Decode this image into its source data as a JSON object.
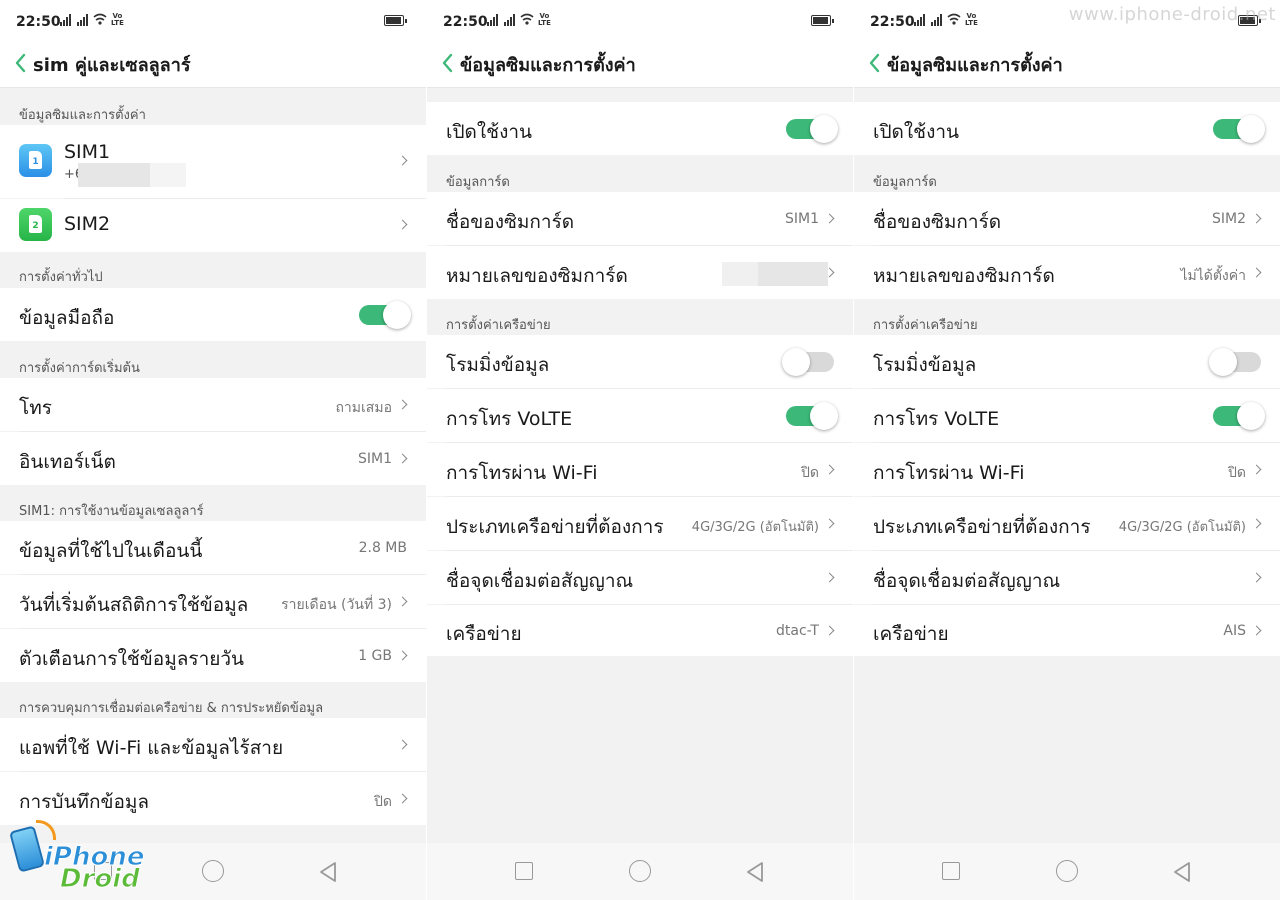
{
  "status": {
    "time": "22:50",
    "volte_top": "Vo",
    "volte_bottom": "LTE"
  },
  "watermark": "www.iphone-droid.net",
  "logo": {
    "line1": "iPhone",
    "line2": "Droid"
  },
  "screen1": {
    "title": "sim คู่และเซลลูลาร์",
    "section_sim": "ข้อมูลซิมและการตั้งค่า",
    "sim1": {
      "name": "SIM1",
      "number_prefix": "+6",
      "icon_digit": "1"
    },
    "sim2": {
      "name": "SIM2",
      "icon_digit": "2"
    },
    "section_general": "การตั้งค่าทั่วไป",
    "mobile_data": {
      "label": "ข้อมูลมือถือ",
      "state": "on"
    },
    "section_default": "การตั้งค่าการ์ดเริ่มต้น",
    "call": {
      "label": "โทร",
      "value": "ถามเสมอ"
    },
    "internet": {
      "label": "อินเทอร์เน็ต",
      "value": "SIM1"
    },
    "section_usage": "SIM1: การใช้งานข้อมูลเซลลูลาร์",
    "used": {
      "label": "ข้อมูลที่ใช้ไปในเดือนนี้",
      "value": "2.8 MB"
    },
    "start_date": {
      "label": "วันที่เริ่มต้นสถิติการใช้ข้อมูล",
      "value": "รายเดือน (วันที่ 3)"
    },
    "daily_alert": {
      "label": "ตัวเตือนการใช้ข้อมูลรายวัน",
      "value": "1 GB"
    },
    "section_control": "การควบคุมการเชื่อมต่อเครือข่าย & การประหยัดข้อมูล",
    "apps_wifi": {
      "label": "แอพที่ใช้ Wi-Fi และข้อมูลไร้สาย"
    },
    "data_saving": {
      "label": "การบันทึกข้อมูล",
      "value": "ปิด"
    }
  },
  "screen2": {
    "title": "ข้อมูลซิมและการตั้งค่า",
    "enable": {
      "label": "เปิดใช้งาน",
      "state": "on"
    },
    "section_card": "ข้อมูลการ์ด",
    "card_name": {
      "label": "ชื่อของซิมการ์ด",
      "value": "SIM1"
    },
    "card_number": {
      "label": "หมายเลขของซิมการ์ด"
    },
    "section_network": "การตั้งค่าเครือข่าย",
    "roaming": {
      "label": "โรมมิ่งข้อมูล",
      "state": "off"
    },
    "volte": {
      "label": "การโทร VoLTE",
      "state": "on"
    },
    "wifi_call": {
      "label": "การโทรผ่าน Wi-Fi",
      "value": "ปิด"
    },
    "network_type": {
      "label": "ประเภทเครือข่ายที่ต้องการ",
      "value": "4G/3G/2G (อัตโนมัติ)"
    },
    "apn": {
      "label": "ชื่อจุดเชื่อมต่อสัญญาณ"
    },
    "carrier": {
      "label": "เครือข่าย",
      "value": "dtac-T"
    }
  },
  "screen3": {
    "title": "ข้อมูลซิมและการตั้งค่า",
    "enable": {
      "label": "เปิดใช้งาน",
      "state": "on"
    },
    "section_card": "ข้อมูลการ์ด",
    "card_name": {
      "label": "ชื่อของซิมการ์ด",
      "value": "SIM2"
    },
    "card_number": {
      "label": "หมายเลขของซิมการ์ด",
      "value": "ไม่ได้ตั้งค่า"
    },
    "section_network": "การตั้งค่าเครือข่าย",
    "roaming": {
      "label": "โรมมิ่งข้อมูล",
      "state": "off"
    },
    "volte": {
      "label": "การโทร VoLTE",
      "state": "on"
    },
    "wifi_call": {
      "label": "การโทรผ่าน Wi-Fi",
      "value": "ปิด"
    },
    "network_type": {
      "label": "ประเภทเครือข่ายที่ต้องการ",
      "value": "4G/3G/2G (อัตโนมัติ)"
    },
    "apn": {
      "label": "ชื่อจุดเชื่อมต่อสัญญาณ"
    },
    "carrier": {
      "label": "เครือข่าย",
      "value": "AIS"
    }
  },
  "colors": {
    "accent": "#3cb878",
    "background": "#f2f2f2",
    "row": "#ffffff",
    "secondary_text": "#777777"
  }
}
